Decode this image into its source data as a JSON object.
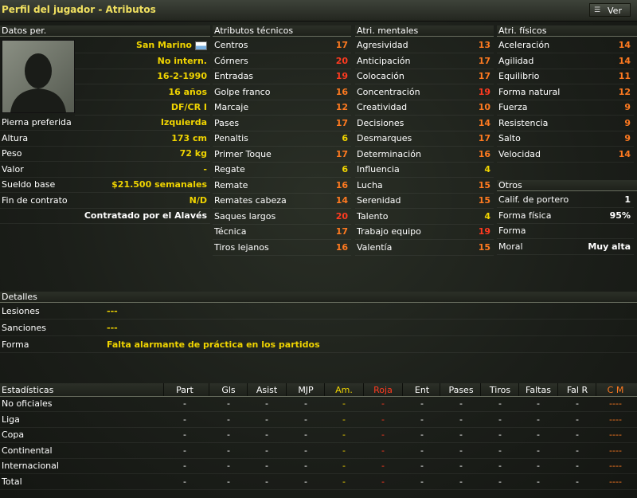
{
  "window": {
    "title": "Perfil del jugador - Atributos",
    "view_button": "Ver"
  },
  "personal": {
    "header": "Datos per.",
    "nationality": "San Marino",
    "intl_status": "No intern.",
    "birth_date": "16-2-1990",
    "age": "16 años",
    "position": "DF/CR I",
    "rows": [
      {
        "label": "Pierna preferida",
        "value": "Izquierda"
      },
      {
        "label": "Altura",
        "value": "173 cm"
      },
      {
        "label": "Peso",
        "value": "72 kg"
      },
      {
        "label": "Valor",
        "value": "-"
      },
      {
        "label": "Sueldo base",
        "value": "$21.500 semanales"
      },
      {
        "label": "Fin de contrato",
        "value": "N/D"
      }
    ],
    "contract_note": "Contratado por el Alavés"
  },
  "technical": {
    "header": "Atributos técnicos",
    "rows": [
      {
        "label": "Centros",
        "value": "17"
      },
      {
        "label": "Córners",
        "value": "20"
      },
      {
        "label": "Entradas",
        "value": "19"
      },
      {
        "label": "Golpe franco",
        "value": "16"
      },
      {
        "label": "Marcaje",
        "value": "12"
      },
      {
        "label": "Pases",
        "value": "17"
      },
      {
        "label": "Penaltis",
        "value": "6"
      },
      {
        "label": "Primer Toque",
        "value": "17"
      },
      {
        "label": "Regate",
        "value": "6"
      },
      {
        "label": "Remate",
        "value": "16"
      },
      {
        "label": "Remates cabeza",
        "value": "14"
      },
      {
        "label": "Saques largos",
        "value": "20"
      },
      {
        "label": "Técnica",
        "value": "17"
      },
      {
        "label": "Tiros lejanos",
        "value": "16"
      }
    ]
  },
  "mental": {
    "header": "Atri. mentales",
    "rows": [
      {
        "label": "Agresividad",
        "value": "13"
      },
      {
        "label": "Anticipación",
        "value": "17"
      },
      {
        "label": "Colocación",
        "value": "17"
      },
      {
        "label": "Concentración",
        "value": "19"
      },
      {
        "label": "Creatividad",
        "value": "10"
      },
      {
        "label": "Decisiones",
        "value": "14"
      },
      {
        "label": "Desmarques",
        "value": "17"
      },
      {
        "label": "Determinación",
        "value": "16"
      },
      {
        "label": "Influencia",
        "value": "4"
      },
      {
        "label": "Lucha",
        "value": "15"
      },
      {
        "label": "Serenidad",
        "value": "15"
      },
      {
        "label": "Talento",
        "value": "4"
      },
      {
        "label": "Trabajo equipo",
        "value": "19"
      },
      {
        "label": "Valentía",
        "value": "15"
      }
    ]
  },
  "physical": {
    "header": "Atri. físicos",
    "rows": [
      {
        "label": "Aceleración",
        "value": "14"
      },
      {
        "label": "Agilidad",
        "value": "14"
      },
      {
        "label": "Equilibrio",
        "value": "11"
      },
      {
        "label": "Forma natural",
        "value": "12"
      },
      {
        "label": "Fuerza",
        "value": "9"
      },
      {
        "label": "Resistencia",
        "value": "9"
      },
      {
        "label": "Salto",
        "value": "9"
      },
      {
        "label": "Velocidad",
        "value": "14"
      }
    ]
  },
  "others": {
    "header": "Otros",
    "rows": [
      {
        "label": "Calif. de portero",
        "value": "1"
      },
      {
        "label": "Forma física",
        "value": "95%"
      },
      {
        "label": "Forma",
        "value": ""
      },
      {
        "label": "Moral",
        "value": "Muy alta"
      }
    ]
  },
  "details": {
    "header": "Detalles",
    "rows": [
      {
        "label": "Lesiones",
        "value": "---"
      },
      {
        "label": "Sanciones",
        "value": "---"
      },
      {
        "label": "Forma",
        "value": "Falta alarmante de práctica en los partidos"
      }
    ]
  },
  "stats": {
    "header": "Estadísticas",
    "columns": [
      "Part",
      "Gls",
      "Asist",
      "MJP",
      "Am.",
      "Roja",
      "Ent",
      "Pases",
      "Tiros",
      "Faltas",
      "Fal R",
      "C M"
    ],
    "rows": [
      {
        "label": "No oficiales",
        "cells": [
          "-",
          "-",
          "-",
          "-",
          "-",
          "-",
          "-",
          "-",
          "-",
          "-",
          "-",
          "----"
        ]
      },
      {
        "label": "Liga",
        "cells": [
          "-",
          "-",
          "-",
          "-",
          "-",
          "-",
          "-",
          "-",
          "-",
          "-",
          "-",
          "----"
        ]
      },
      {
        "label": "Copa",
        "cells": [
          "-",
          "-",
          "-",
          "-",
          "-",
          "-",
          "-",
          "-",
          "-",
          "-",
          "-",
          "----"
        ]
      },
      {
        "label": "Continental",
        "cells": [
          "-",
          "-",
          "-",
          "-",
          "-",
          "-",
          "-",
          "-",
          "-",
          "-",
          "-",
          "----"
        ]
      },
      {
        "label": "Internacional",
        "cells": [
          "-",
          "-",
          "-",
          "-",
          "-",
          "-",
          "-",
          "-",
          "-",
          "-",
          "-",
          "----"
        ]
      },
      {
        "label": "Total",
        "cells": [
          "-",
          "-",
          "-",
          "-",
          "-",
          "-",
          "-",
          "-",
          "-",
          "-",
          "-",
          "----"
        ]
      }
    ]
  },
  "colors": {
    "yellow": "#f0d400",
    "orange": "#ff7a20",
    "red": "#ff3a20"
  }
}
